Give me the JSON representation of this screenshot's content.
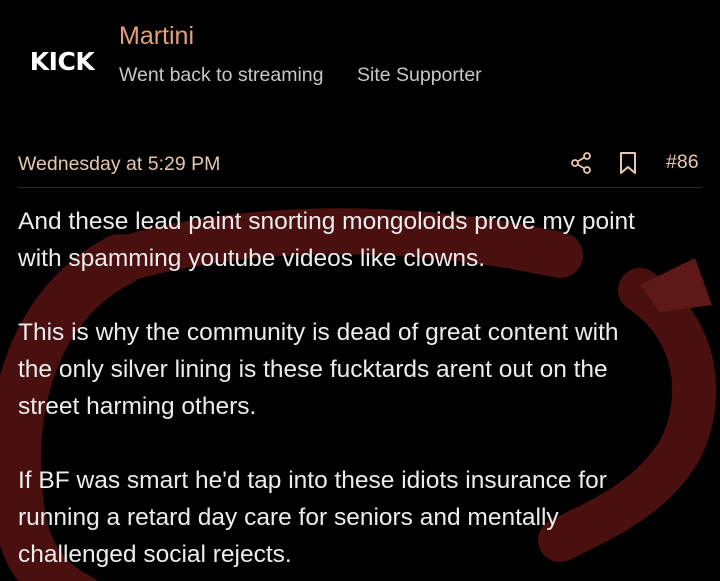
{
  "user": {
    "avatar_text": "KICK",
    "name": "Martini",
    "status": "Went back to streaming",
    "role": "Site Supporter"
  },
  "post": {
    "date": "Wednesday at 5:29 PM",
    "number": "#86",
    "paragraphs": [
      "And these lead paint snorting mongoloids prove my point\nwith spamming youtube videos like clowns.",
      "This is why the community is dead of great content with\nthe only silver lining is these fucktards arent out on the\nstreet harming others.",
      "If BF was smart he'd tap into these idiots insurance for\nrunning a retard day care for seniors and mentally\nchallenged social rejects."
    ]
  },
  "icons": {
    "share": "share-icon",
    "bookmark": "bookmark-icon"
  },
  "colors": {
    "background": "#000000",
    "username": "#e59f73",
    "meta_text": "#e8c7ad",
    "body_text": "#ececec",
    "secondary_text": "#c7c7c7",
    "swirl": "#5a1414"
  }
}
